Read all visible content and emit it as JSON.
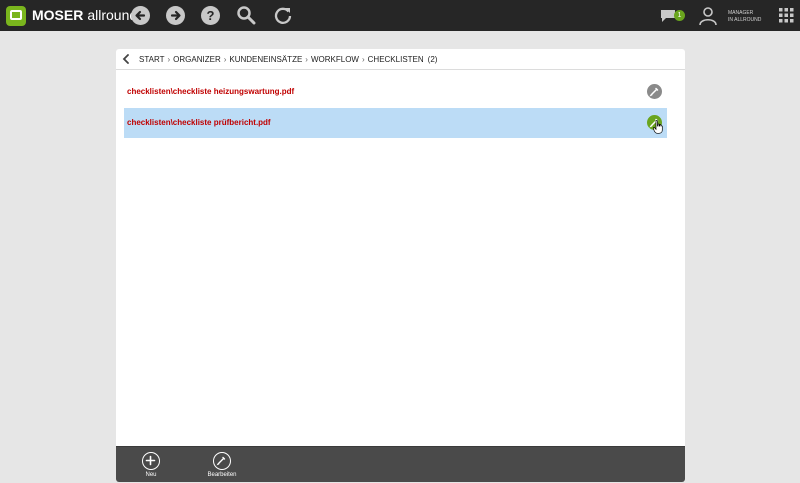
{
  "app": {
    "brand_bold": "MOSER",
    "brand_light": "allround",
    "accent_color": "#7ab51d"
  },
  "topbar": {
    "icons": [
      "back-arrow-icon",
      "forward-arrow-icon",
      "help-icon",
      "search-icon",
      "refresh-icon",
      "messages-icon",
      "user-icon",
      "apps-grid-icon"
    ],
    "messages_count": "1",
    "user_line1": "MANAGER",
    "user_line2": "IN ALLROUND"
  },
  "breadcrumb": {
    "items": [
      "START",
      "ORGANIZER",
      "KUNDENEINSÄTZE",
      "WORKFLOW",
      "CHECKLISTEN"
    ],
    "separator": "›",
    "count": "(2)"
  },
  "list": {
    "items": [
      {
        "label": "checklisten\\checkliste heizungswartung.pdf",
        "selected": false
      },
      {
        "label": "checklisten\\checkliste prüfbericht.pdf",
        "selected": true
      }
    ],
    "link_color": "#c00000",
    "selected_bg": "#bcdcf6"
  },
  "toolbar": {
    "new_label": "Neu",
    "edit_label": "Bearbeiten"
  }
}
